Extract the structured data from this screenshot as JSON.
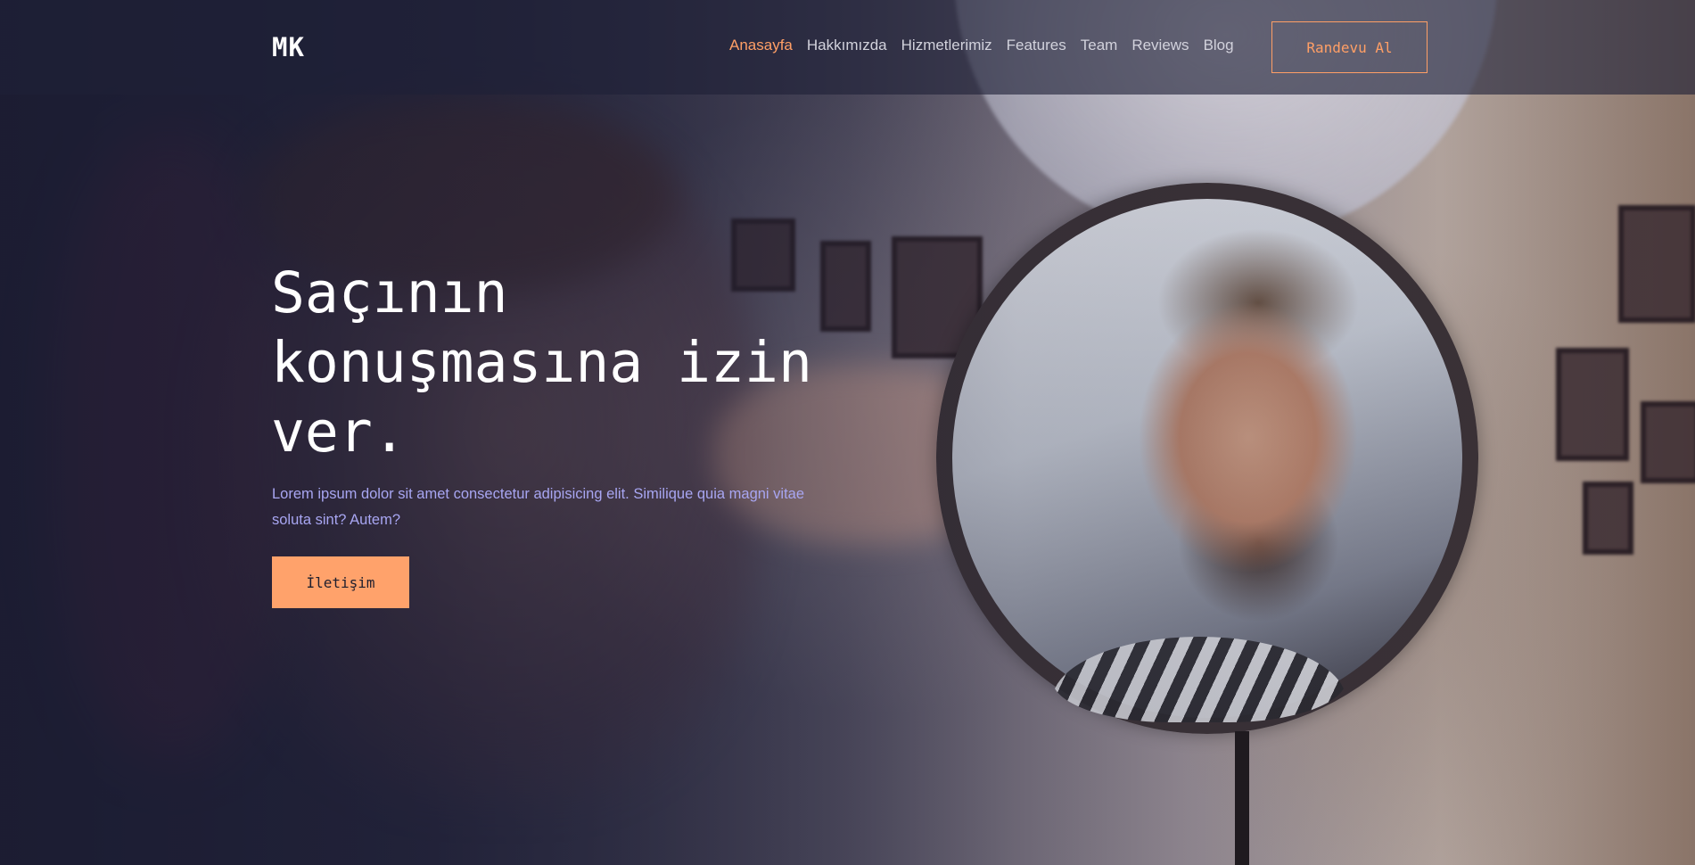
{
  "brand": {
    "logo": "MK"
  },
  "nav": {
    "items": [
      {
        "label": "Anasayfa",
        "active": true
      },
      {
        "label": "Hakkımızda",
        "active": false
      },
      {
        "label": "Hizmetlerimiz",
        "active": false
      },
      {
        "label": "Features",
        "active": false
      },
      {
        "label": "Team",
        "active": false
      },
      {
        "label": "Reviews",
        "active": false
      },
      {
        "label": "Blog",
        "active": false
      }
    ],
    "cta_label": "Randevu Al"
  },
  "hero": {
    "title": "Saçının konuşmasına izin ver.",
    "text": "Lorem ipsum dolor sit amet consectetur adipisicing elit. Similique quia magni vitae soluta sint? Autem?",
    "button_label": "İletişim"
  },
  "colors": {
    "accent": "#ff9f66",
    "text_muted": "#a8a6f2",
    "background": "#1c1d33"
  }
}
